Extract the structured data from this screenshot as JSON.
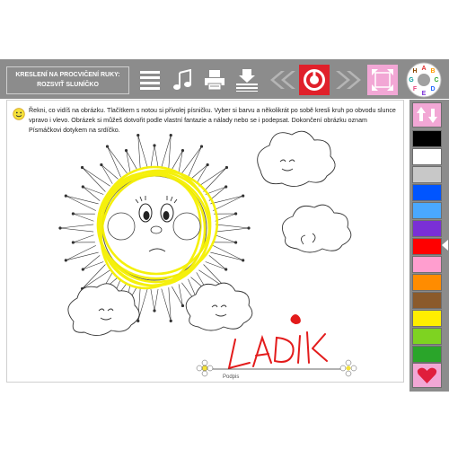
{
  "title": {
    "line1": "KRESLENÍ NA PROCVIČENÍ RUKY:",
    "line2": "ROZSVIŤ SLUNÍČKO"
  },
  "instructions": "Řekni, co vidíš na obrázku. Tlačítkem s notou si přivolej písničku. Vyber si barvu a několikrát po sobě kresli kruh po obvodu slunce vpravo i vlevo. Obrázek si můžeš dotvořit podle vlastní fantazie a nálady nebo se i podepsat. Dokončení obrázku oznam Písmáčkovi dotykem na srdíčko.",
  "toolbar": {
    "menu_icon": "menu-icon",
    "music_icon": "music-note-icon",
    "print_icon": "print-icon",
    "save_icon": "download-icon",
    "back_icon": "double-chevron-left-icon",
    "reset_icon": "reset-icon",
    "forward_icon": "double-chevron-right-icon",
    "fullscreen_icon": "fullscreen-icon",
    "abc_logo_letters": "ABCDEFGH"
  },
  "drawing": {
    "signature_label": "Podpis",
    "signature_text": "LADIK"
  },
  "palette": {
    "colors": [
      "#000000",
      "#ffffff",
      "#c8c8c8",
      "#0055ff",
      "#4aa8ff",
      "#7a2fd6",
      "#ff0000",
      "#ff9ecf",
      "#ff8c00",
      "#8b5a2b",
      "#ffee00",
      "#7ed321",
      "#2aa52a"
    ],
    "accent": "#e8467c"
  }
}
